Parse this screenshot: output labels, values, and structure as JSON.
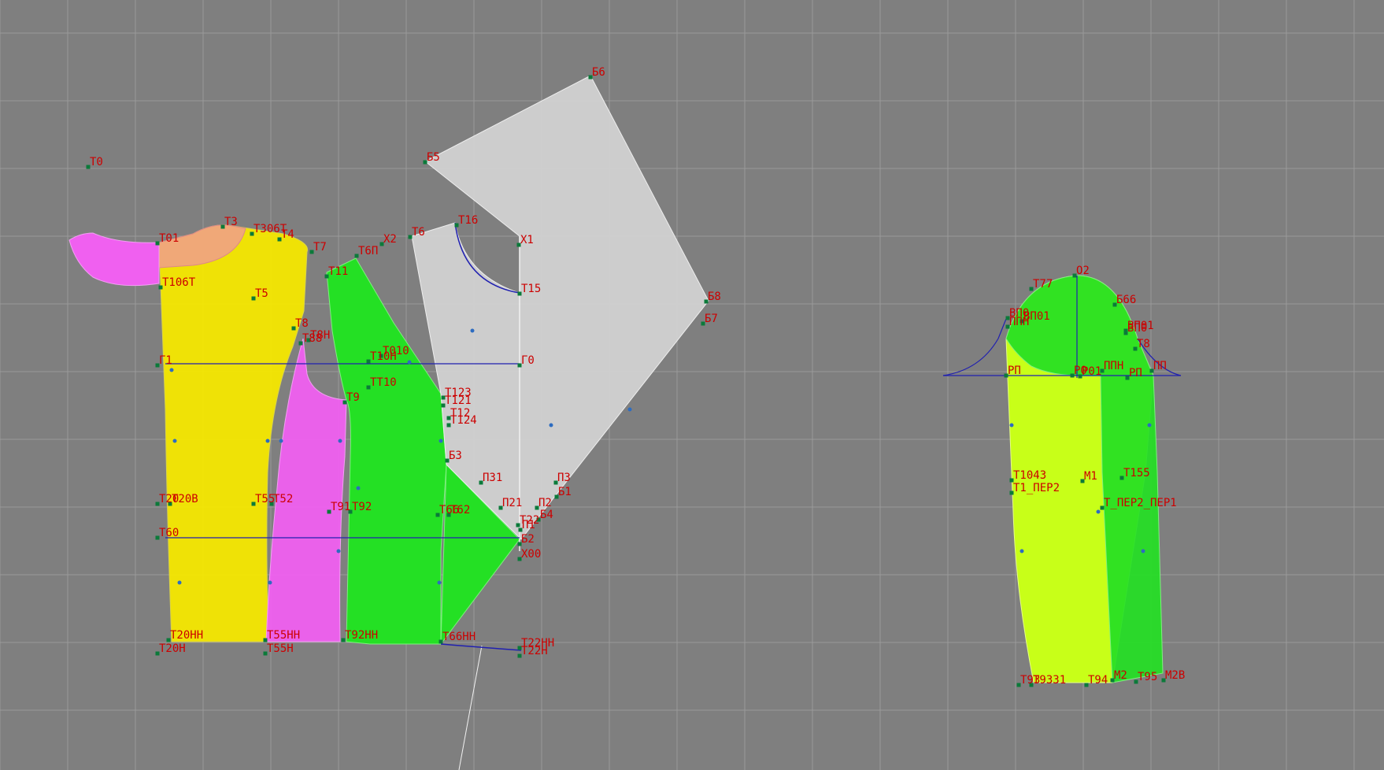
{
  "colors": {
    "background": "#7f7f7f",
    "grid": "#9a9a9a",
    "yellow": "#f5e800",
    "magenta": "#f060f0",
    "green": "#24e024",
    "lime": "#c8ff18",
    "gray_piece": "#d2d2d2",
    "peach": "#f0a878",
    "label": "#cc0000",
    "construction_line": "#2020b0",
    "point": "#0b7a3a",
    "control_point": "#2d6cc0"
  },
  "grid": {
    "visible": true
  },
  "pieces": [
    {
      "id": "back",
      "color": "yellow"
    },
    {
      "id": "back-collar",
      "color": "magenta"
    },
    {
      "id": "side-panel",
      "color": "magenta"
    },
    {
      "id": "front",
      "color": "green"
    },
    {
      "id": "front-lower",
      "color": "green"
    },
    {
      "id": "front-facing",
      "color": "gray_piece"
    },
    {
      "id": "sleeve-upper",
      "color": "lime"
    },
    {
      "id": "sleeve-under",
      "color": "green"
    }
  ],
  "labels": [
    "T0",
    "T01",
    "T3",
    "T306T",
    "T4",
    "T7",
    "T6П",
    "X2",
    "T6",
    "T16",
    "X1",
    "Б6",
    "Б5",
    "T106T",
    "T5",
    "T11",
    "T15",
    "Б8",
    "Б7",
    "T8",
    "T8H",
    "T88",
    "Г1",
    "T010",
    "T10H",
    "Г0",
    "TT10",
    "T9",
    "T123",
    "T121",
    "T12",
    "T124",
    "Б3",
    "П31",
    "П3",
    "Б1",
    "T20",
    "T20B",
    "T55",
    "T52",
    "T91",
    "T92",
    "T66",
    "T62",
    "П21",
    "П2",
    "T22",
    "П1",
    "Б4",
    "Б2",
    "T60",
    "X00",
    "T20HH",
    "T55HH",
    "T92HH",
    "T66HH",
    "T22HH",
    "T20H",
    "T55H",
    "T22H",
    "O2",
    "T77",
    "Б66",
    "ВП0",
    "ВП01",
    "ППН",
    "ВП01",
    "ВП0",
    "T8",
    "РП",
    "Р0",
    "Р01",
    "ППН",
    "ПП",
    "РП",
    "T1043",
    "T1_ПЕР2",
    "M1",
    "T155",
    "T_ПЕР2_ПЕР1",
    "T93",
    "T9331",
    "T94",
    "M2",
    "T95",
    "M2B"
  ]
}
